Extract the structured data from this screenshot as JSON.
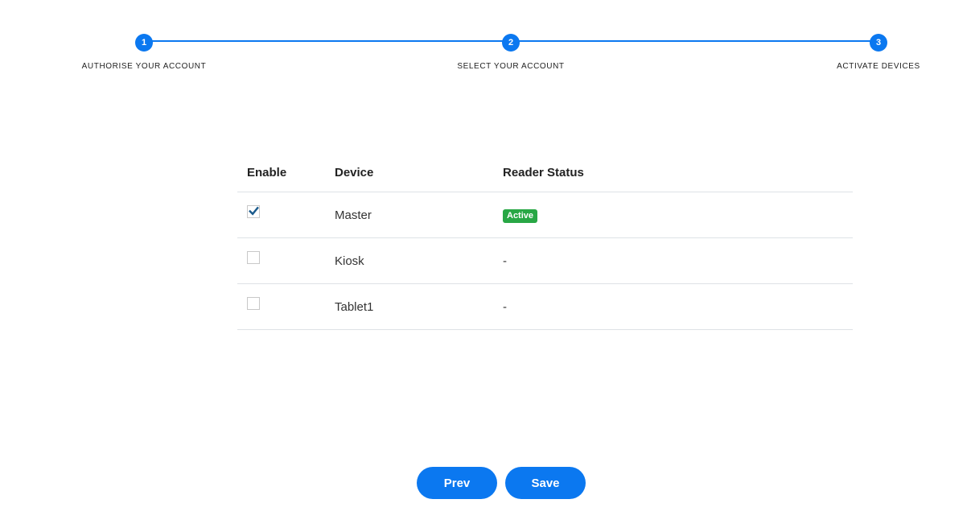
{
  "stepper": {
    "steps": [
      {
        "number": "1",
        "label": "AUTHORISE YOUR ACCOUNT"
      },
      {
        "number": "2",
        "label": "SELECT YOUR ACCOUNT"
      },
      {
        "number": "3",
        "label": "ACTIVATE DEVICES"
      }
    ]
  },
  "table": {
    "headers": {
      "enable": "Enable",
      "device": "Device",
      "status": "Reader Status"
    },
    "rows": [
      {
        "checked": true,
        "device": "Master",
        "status": "Active"
      },
      {
        "checked": false,
        "device": "Kiosk",
        "status": "-"
      },
      {
        "checked": false,
        "device": "Tablet1",
        "status": "-"
      }
    ]
  },
  "buttons": {
    "prev": "Prev",
    "save": "Save"
  },
  "colors": {
    "accent": "#0b78f0",
    "active_badge": "#28a745"
  }
}
